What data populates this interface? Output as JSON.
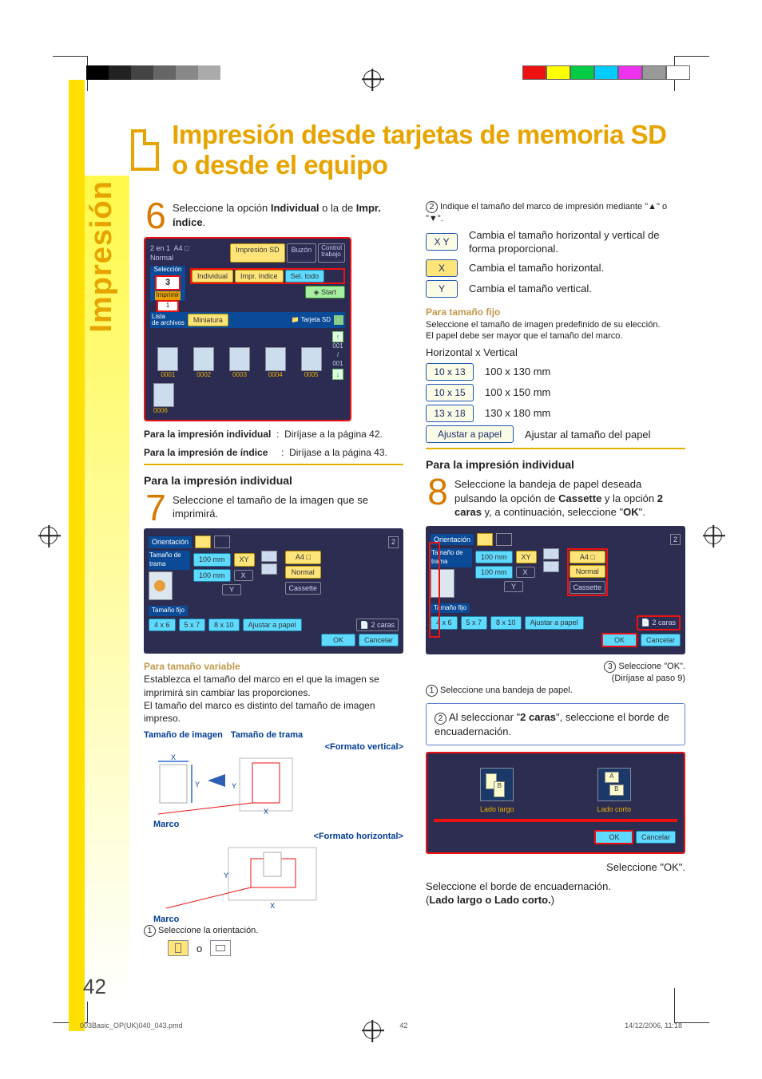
{
  "page": {
    "number": "42",
    "title": "Impresión desde tarjetas de memoria SD o desde el equipo",
    "sidebar_label": "Impresión",
    "footer_file": "003Basic_OP(UK)040_043.pmd",
    "footer_page": "42",
    "footer_time": "14/12/2006, 11:18"
  },
  "step6": {
    "num": "6",
    "text_a": "Seleccione la opción ",
    "bold_a": "Individual",
    "text_b": " o la de ",
    "bold_b": "Impr. índice",
    "period": ".",
    "screen": {
      "header": "2 en 1  A4 □\nNormal",
      "sel": "Selección",
      "c3": "3",
      "c1": "1",
      "imprimir": "Imprimir",
      "tabs": {
        "sd": "Impresión SD",
        "buzon": "Buzón",
        "control": "Control\ntrabajo"
      },
      "btns": {
        "indiv": "Individual",
        "indice": "Impr. índice",
        "sel_todo": "Sel. todo",
        "start": "Start"
      },
      "bar_left": "Lista\nde archivos",
      "bar_mid": "Miniatura",
      "bar_right": "Tarjeta SD",
      "thumbs": [
        "0001",
        "0002",
        "0003",
        "0004",
        "0005",
        "0006"
      ],
      "cnt": "001\n/\n001"
    },
    "ref1_a": "Para la impresión individual",
    "ref1_b": ":",
    "ref1_c": "Diríjase a la página 42.",
    "ref2_a": "Para la impresión de índice",
    "ref2_b": ":",
    "ref2_c": "Diríjase a la página 43."
  },
  "indiv_head": "Para la impresión individual",
  "step7": {
    "num": "7",
    "text": "Seleccione el tamaño de la imagen que se imprimirá.",
    "screen": {
      "orient": "Orientación",
      "tam_tram": "Tamaño de trama",
      "xy": "XY",
      "x": "X",
      "y": "Y",
      "v1": "100 mm",
      "v2": "100 mm",
      "normal": "Normal",
      "a4": "A4 □",
      "two": "2",
      "cassette": "Cassette",
      "fijo": "Tamaño fijo",
      "s1": "4 x 6",
      "s2": "5 x 7",
      "s3": "8 x 10",
      "s4": "Ajustar a papel",
      "two_side": "2 caras",
      "ok": "OK",
      "cancel": "Cancelar"
    },
    "variable_head": "Para tamaño variable",
    "variable_p1": "Establezca el tamaño del marco en el que la imagen se imprimirá sin cambiar las proporciones.",
    "variable_p2": "El tamaño del marco es distinto del tamaño de imagen impreso.",
    "lbl_img": "Tamaño de imagen",
    "lbl_tram": "Tamaño de trama",
    "fmt_v": "<Formato vertical>",
    "fmt_h": "<Formato horizontal>",
    "marco": "Marco",
    "sel_orient_n": "1",
    "sel_orient": "Seleccione la orientación.",
    "o": "o"
  },
  "rightcol": {
    "frame_n": "2",
    "frame_a": "Indique el tamaño del marco de impresión mediante \"",
    "frame_up": "▲",
    "frame_mid": "\" o \"",
    "frame_dn": "▼",
    "frame_b": "\".",
    "xy_lbl": "X Y",
    "xy_desc": "Cambia el tamaño horizontal y vertical de forma proporcional.",
    "x_lbl": "X",
    "x_desc": "Cambia el tamaño horizontal.",
    "y_lbl": "Y",
    "y_desc": "Cambia el tamaño vertical.",
    "fijo_head": "Para tamaño fijo",
    "fijo_p1": "Seleccione el tamaño de imagen predefinido de su elección.",
    "fijo_p2": "El papel debe ser mayor que el tamaño del marco.",
    "hxv": "Horizontal x Vertical",
    "sizes": [
      {
        "btn": "10 x 13",
        "txt": "100 x 130 mm"
      },
      {
        "btn": "10 x 15",
        "txt": "100 x 150 mm"
      },
      {
        "btn": "13 x 18",
        "txt": "130 x 180 mm"
      },
      {
        "btn": "Ajustar a papel",
        "txt": "Ajustar al tamaño del papel"
      }
    ],
    "indiv2": "Para la impresión individual",
    "step8_num": "8",
    "step8_a": "Seleccione la bandeja de papel deseada pulsando la opción de ",
    "step8_b": "Cassette",
    "step8_c": " y la opción ",
    "step8_d": "2 caras",
    "step8_e": " y, a continuación, seleccione \"",
    "step8_f": "OK",
    "step8_g": "\".",
    "sel_ok_n": "3",
    "sel_ok": "Seleccione \"OK\".",
    "goto9": "(Diríjase al paso 9)",
    "sel_band_n": "1",
    "sel_band": "Seleccione una bandeja de papel.",
    "callout_n": "2",
    "callout_a": "Al seleccionar \"",
    "callout_b": "2 caras",
    "callout_c": "\", seleccione el borde de encuadernación.",
    "ll": "Lado largo",
    "lc": "Lado corto",
    "ok": "OK",
    "cancel": "Cancelar",
    "sel_ok2": "Seleccione \"OK\".",
    "borde": "Seleccione el borde de encuadernación.",
    "borde2": "(Lado largo o Lado corto.)"
  }
}
